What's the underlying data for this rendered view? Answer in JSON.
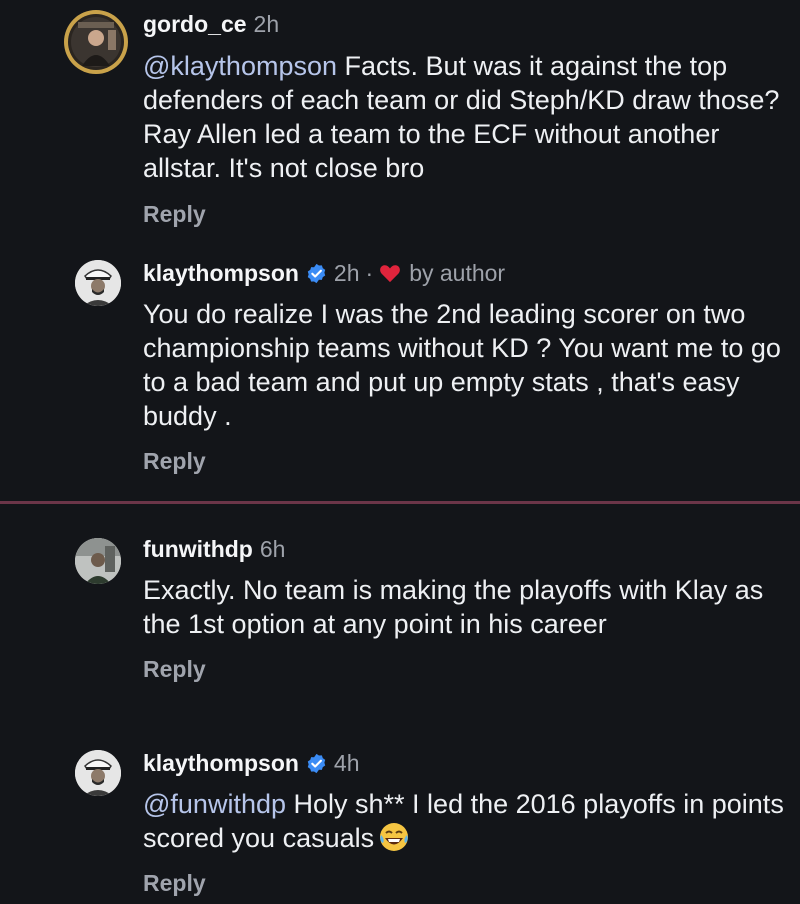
{
  "comments": [
    {
      "username": "gordo_ce",
      "time": "2h",
      "mention": "@klaythompson",
      "text": " Facts. But was it against the top defenders of each team or did Steph/KD draw those? Ray Allen led a team to the ECF without another allstar. It's not close bro",
      "reply": "Reply"
    },
    {
      "username": "klaythompson",
      "time": "2h",
      "separator": "·",
      "liked_label": "by author",
      "text": "You do realize I was the 2nd leading scorer on two championship teams without KD ? You want me to go to a bad team and put up empty stats , that's easy buddy .",
      "reply": "Reply"
    },
    {
      "username": "funwithdp",
      "time": "6h",
      "text": "Exactly. No team is making the playoffs with Klay as the 1st option at any point in his career",
      "reply": "Reply"
    },
    {
      "username": "klaythompson",
      "time": "4h",
      "mention": "@funwithdp",
      "text": " Holy sh** I led the 2016 playoffs in points scored you casuals",
      "reply": "Reply"
    }
  ],
  "icons": {
    "verified": "verified-badge-icon",
    "heart": "heart-icon",
    "emoji": "laughing-tears-emoji"
  },
  "colors": {
    "background": "#131519",
    "mention": "#b6c5ea",
    "secondary_text": "#9ea2aa",
    "verified": "#3b8cf5",
    "heart": "#e0243c",
    "divider": "#6b3548"
  }
}
